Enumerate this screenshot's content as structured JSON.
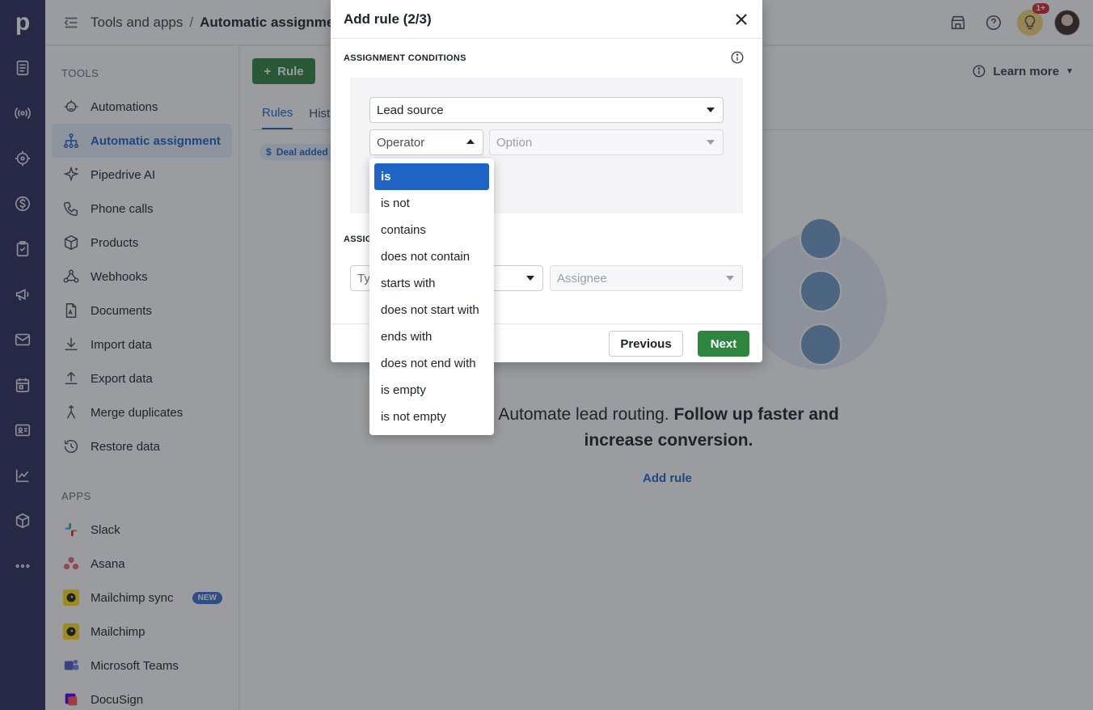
{
  "app": {
    "logo": "p"
  },
  "header": {
    "breadcrumb_root": "Tools and apps",
    "breadcrumb_sep": "/",
    "breadcrumb_current": "Automatic assignment",
    "notification_count": "1+"
  },
  "sidebar": {
    "tools_title": "TOOLS",
    "apps_title": "APPS",
    "tools": [
      {
        "label": "Automations",
        "icon": "robot-icon"
      },
      {
        "label": "Automatic assignment",
        "icon": "assignment-icon",
        "active": true
      },
      {
        "label": "Pipedrive AI",
        "icon": "sparkle-icon"
      },
      {
        "label": "Phone calls",
        "icon": "phone-icon"
      },
      {
        "label": "Products",
        "icon": "box-icon"
      },
      {
        "label": "Webhooks",
        "icon": "webhook-icon"
      },
      {
        "label": "Documents",
        "icon": "document-icon"
      },
      {
        "label": "Import data",
        "icon": "download-icon"
      },
      {
        "label": "Export data",
        "icon": "upload-icon"
      },
      {
        "label": "Merge duplicates",
        "icon": "merge-icon"
      },
      {
        "label": "Restore data",
        "icon": "restore-icon"
      }
    ],
    "apps": [
      {
        "label": "Slack",
        "icon": "slack-icon"
      },
      {
        "label": "Asana",
        "icon": "asana-icon"
      },
      {
        "label": "Mailchimp sync",
        "icon": "mailchimp-icon",
        "badge": "NEW"
      },
      {
        "label": "Mailchimp",
        "icon": "mailchimp-icon"
      },
      {
        "label": "Microsoft Teams",
        "icon": "teams-icon"
      },
      {
        "label": "DocuSign",
        "icon": "docusign-icon"
      }
    ]
  },
  "main": {
    "rule_button": "Rule",
    "learn_more": "Learn more",
    "tabs": [
      "Rules",
      "Hist"
    ],
    "deal_chip": "Deal added",
    "empty_message_plain": "Automate lead routing.",
    "empty_message_bold": "Follow up faster and increase conversion.",
    "add_rule_link": "Add rule"
  },
  "modal": {
    "title": "Add rule (2/3)",
    "conditions_title": "ASSIGNMENT CONDITIONS",
    "lead_source_value": "Lead source",
    "operator_placeholder": "Operator",
    "option_placeholder": "Option",
    "assign_label": "ASSIG",
    "type_placeholder": "Ty",
    "assignee_placeholder": "Assignee",
    "previous_button": "Previous",
    "next_button": "Next"
  },
  "operator_dropdown": {
    "selected": "is",
    "options": [
      "is",
      "is not",
      "contains",
      "does not contain",
      "starts with",
      "does not start with",
      "ends with",
      "does not end with",
      "is empty",
      "is not empty"
    ]
  },
  "colors": {
    "rail": "#2b2c5c",
    "accent_blue": "#1f64c4",
    "primary_green": "#2e8540"
  }
}
